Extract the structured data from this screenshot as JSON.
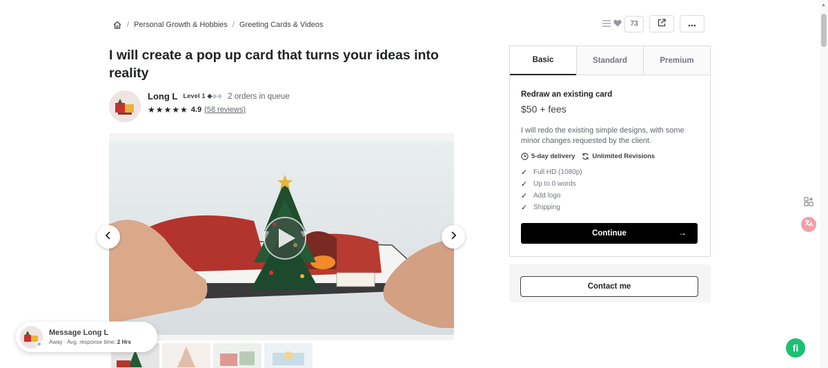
{
  "breadcrumb": {
    "items": [
      "Personal Growth & Hobbies",
      "Greeting Cards & Videos"
    ]
  },
  "actions": {
    "likes_count": "73"
  },
  "gig": {
    "title": "I will create a pop up card that turns your ideas into reality"
  },
  "seller": {
    "name": "Long L",
    "level": "Level 1",
    "orders_in_queue": "2 orders in queue",
    "stars": "★★★★★",
    "rating": "4.9",
    "reviews": "(58 reviews)"
  },
  "packages": {
    "tabs": [
      "Basic",
      "Standard",
      "Premium"
    ],
    "active_tab": "Basic",
    "title": "Redraw an existing card",
    "price": "$50 + fees",
    "description": "I will redo the existing simple designs, with some minor changes requested by the client.",
    "delivery": "5-day delivery",
    "revisions": "Unlimited Revisions",
    "features": [
      "Full HD (1080p)",
      "Up to 0 words",
      "Add logo",
      "Shipping"
    ],
    "continue_label": "Continue",
    "continue_arrow": "→"
  },
  "contact": {
    "label": "Contact me"
  },
  "message_bubble": {
    "title": "Message Long L",
    "status": "Away",
    "response_label": "Avg. response time:",
    "response_value": "2 Hrs"
  },
  "badge": {
    "letters": "fi"
  },
  "colors": {
    "accent_green": "#1dbf73",
    "button_black": "#000000",
    "text_dark": "#222325"
  }
}
